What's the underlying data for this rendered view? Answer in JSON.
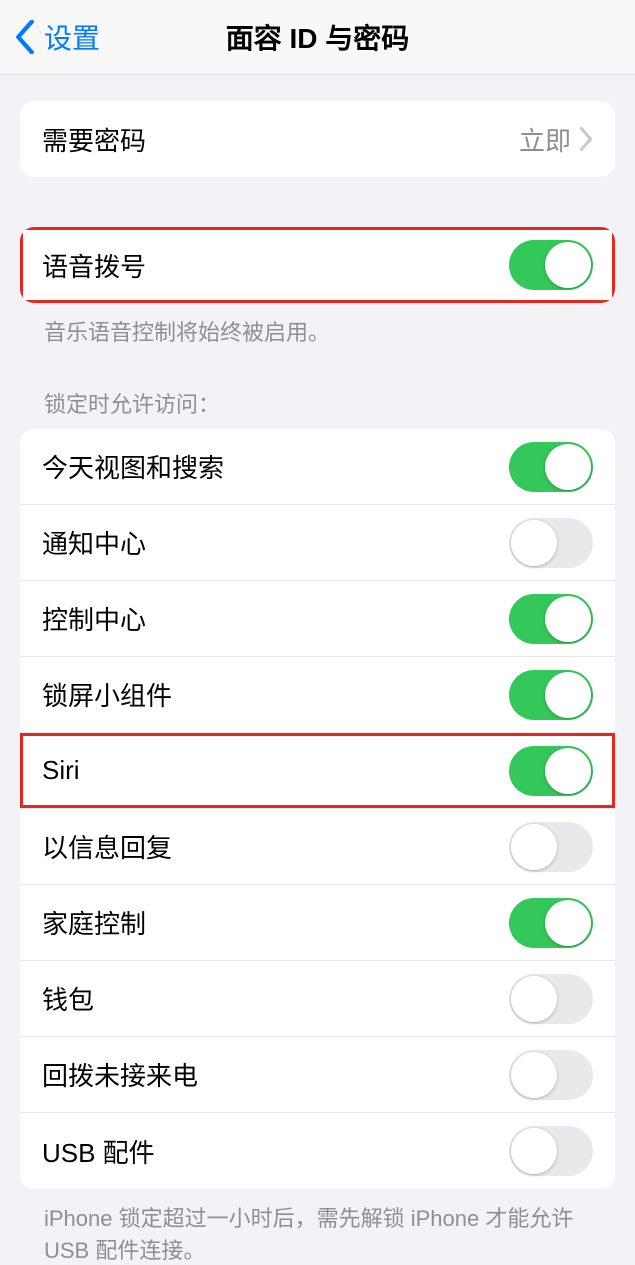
{
  "nav": {
    "back_label": "设置",
    "title": "面容 ID 与密码"
  },
  "require_passcode": {
    "label": "需要密码",
    "value": "立即"
  },
  "voice_dial": {
    "label": "语音拨号",
    "on": true,
    "footer": "音乐语音控制将始终被启用。"
  },
  "lock_access": {
    "header": "锁定时允许访问：",
    "items": [
      {
        "id": "today",
        "label": "今天视图和搜索",
        "on": true,
        "highlight": false
      },
      {
        "id": "notif",
        "label": "通知中心",
        "on": false,
        "highlight": false
      },
      {
        "id": "control",
        "label": "控制中心",
        "on": true,
        "highlight": false
      },
      {
        "id": "widgets",
        "label": "锁屏小组件",
        "on": true,
        "highlight": false
      },
      {
        "id": "siri",
        "label": "Siri",
        "on": true,
        "highlight": true
      },
      {
        "id": "reply_msg",
        "label": "以信息回复",
        "on": false,
        "highlight": false
      },
      {
        "id": "home",
        "label": "家庭控制",
        "on": true,
        "highlight": false
      },
      {
        "id": "wallet",
        "label": "钱包",
        "on": false,
        "highlight": false
      },
      {
        "id": "return_call",
        "label": "回拨未接来电",
        "on": false,
        "highlight": false
      },
      {
        "id": "usb",
        "label": "USB 配件",
        "on": false,
        "highlight": false
      }
    ],
    "footer": "iPhone 锁定超过一小时后，需先解锁 iPhone 才能允许 USB 配件连接。"
  }
}
